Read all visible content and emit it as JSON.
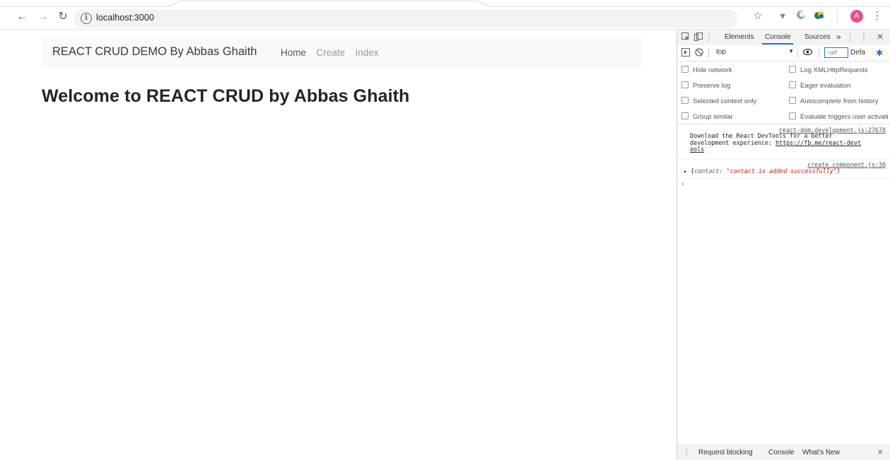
{
  "browser": {
    "url": "localhost:3000"
  },
  "navbar": {
    "brand": "REACT CRUD DEMO By Abbas Ghaith",
    "links": [
      "Home",
      "Create",
      "Index"
    ]
  },
  "main": {
    "heading": "Welcome to REACT CRUD by Abbas Ghaith"
  },
  "devtools": {
    "tabs": [
      "Elements",
      "Console",
      "Sources",
      "»"
    ],
    "active_tab": "Console",
    "context": "top",
    "filter_placeholder": "-url",
    "levels": "Defa",
    "settings": {
      "left": [
        "Hide network",
        "Preserve log",
        "Selected context only",
        "Group similar"
      ],
      "right": [
        "Log XMLHttpRequests",
        "Eager evaluation",
        "Autocomplete from history",
        "Evaluate triggers user activati"
      ]
    },
    "messages": [
      {
        "source": "react-dom.development.js:27678",
        "line1": "Download the React DevTools for a better",
        "line2_prefix": "development experience: ",
        "line2_link": "https://fb.me/react-devt",
        "line3_link": "ools"
      },
      {
        "source": "create.component.js:36",
        "obj_open": "▸ {",
        "obj_key": "contact: ",
        "obj_value": "\"contact is added successfully\"",
        "obj_close": "}"
      }
    ],
    "drawer_tabs": [
      "Request blocking",
      "Console",
      "What's New"
    ]
  },
  "colors": {
    "accent": "#1a73e8",
    "avatar": "#e0528e",
    "string_red": "#c41a16"
  }
}
